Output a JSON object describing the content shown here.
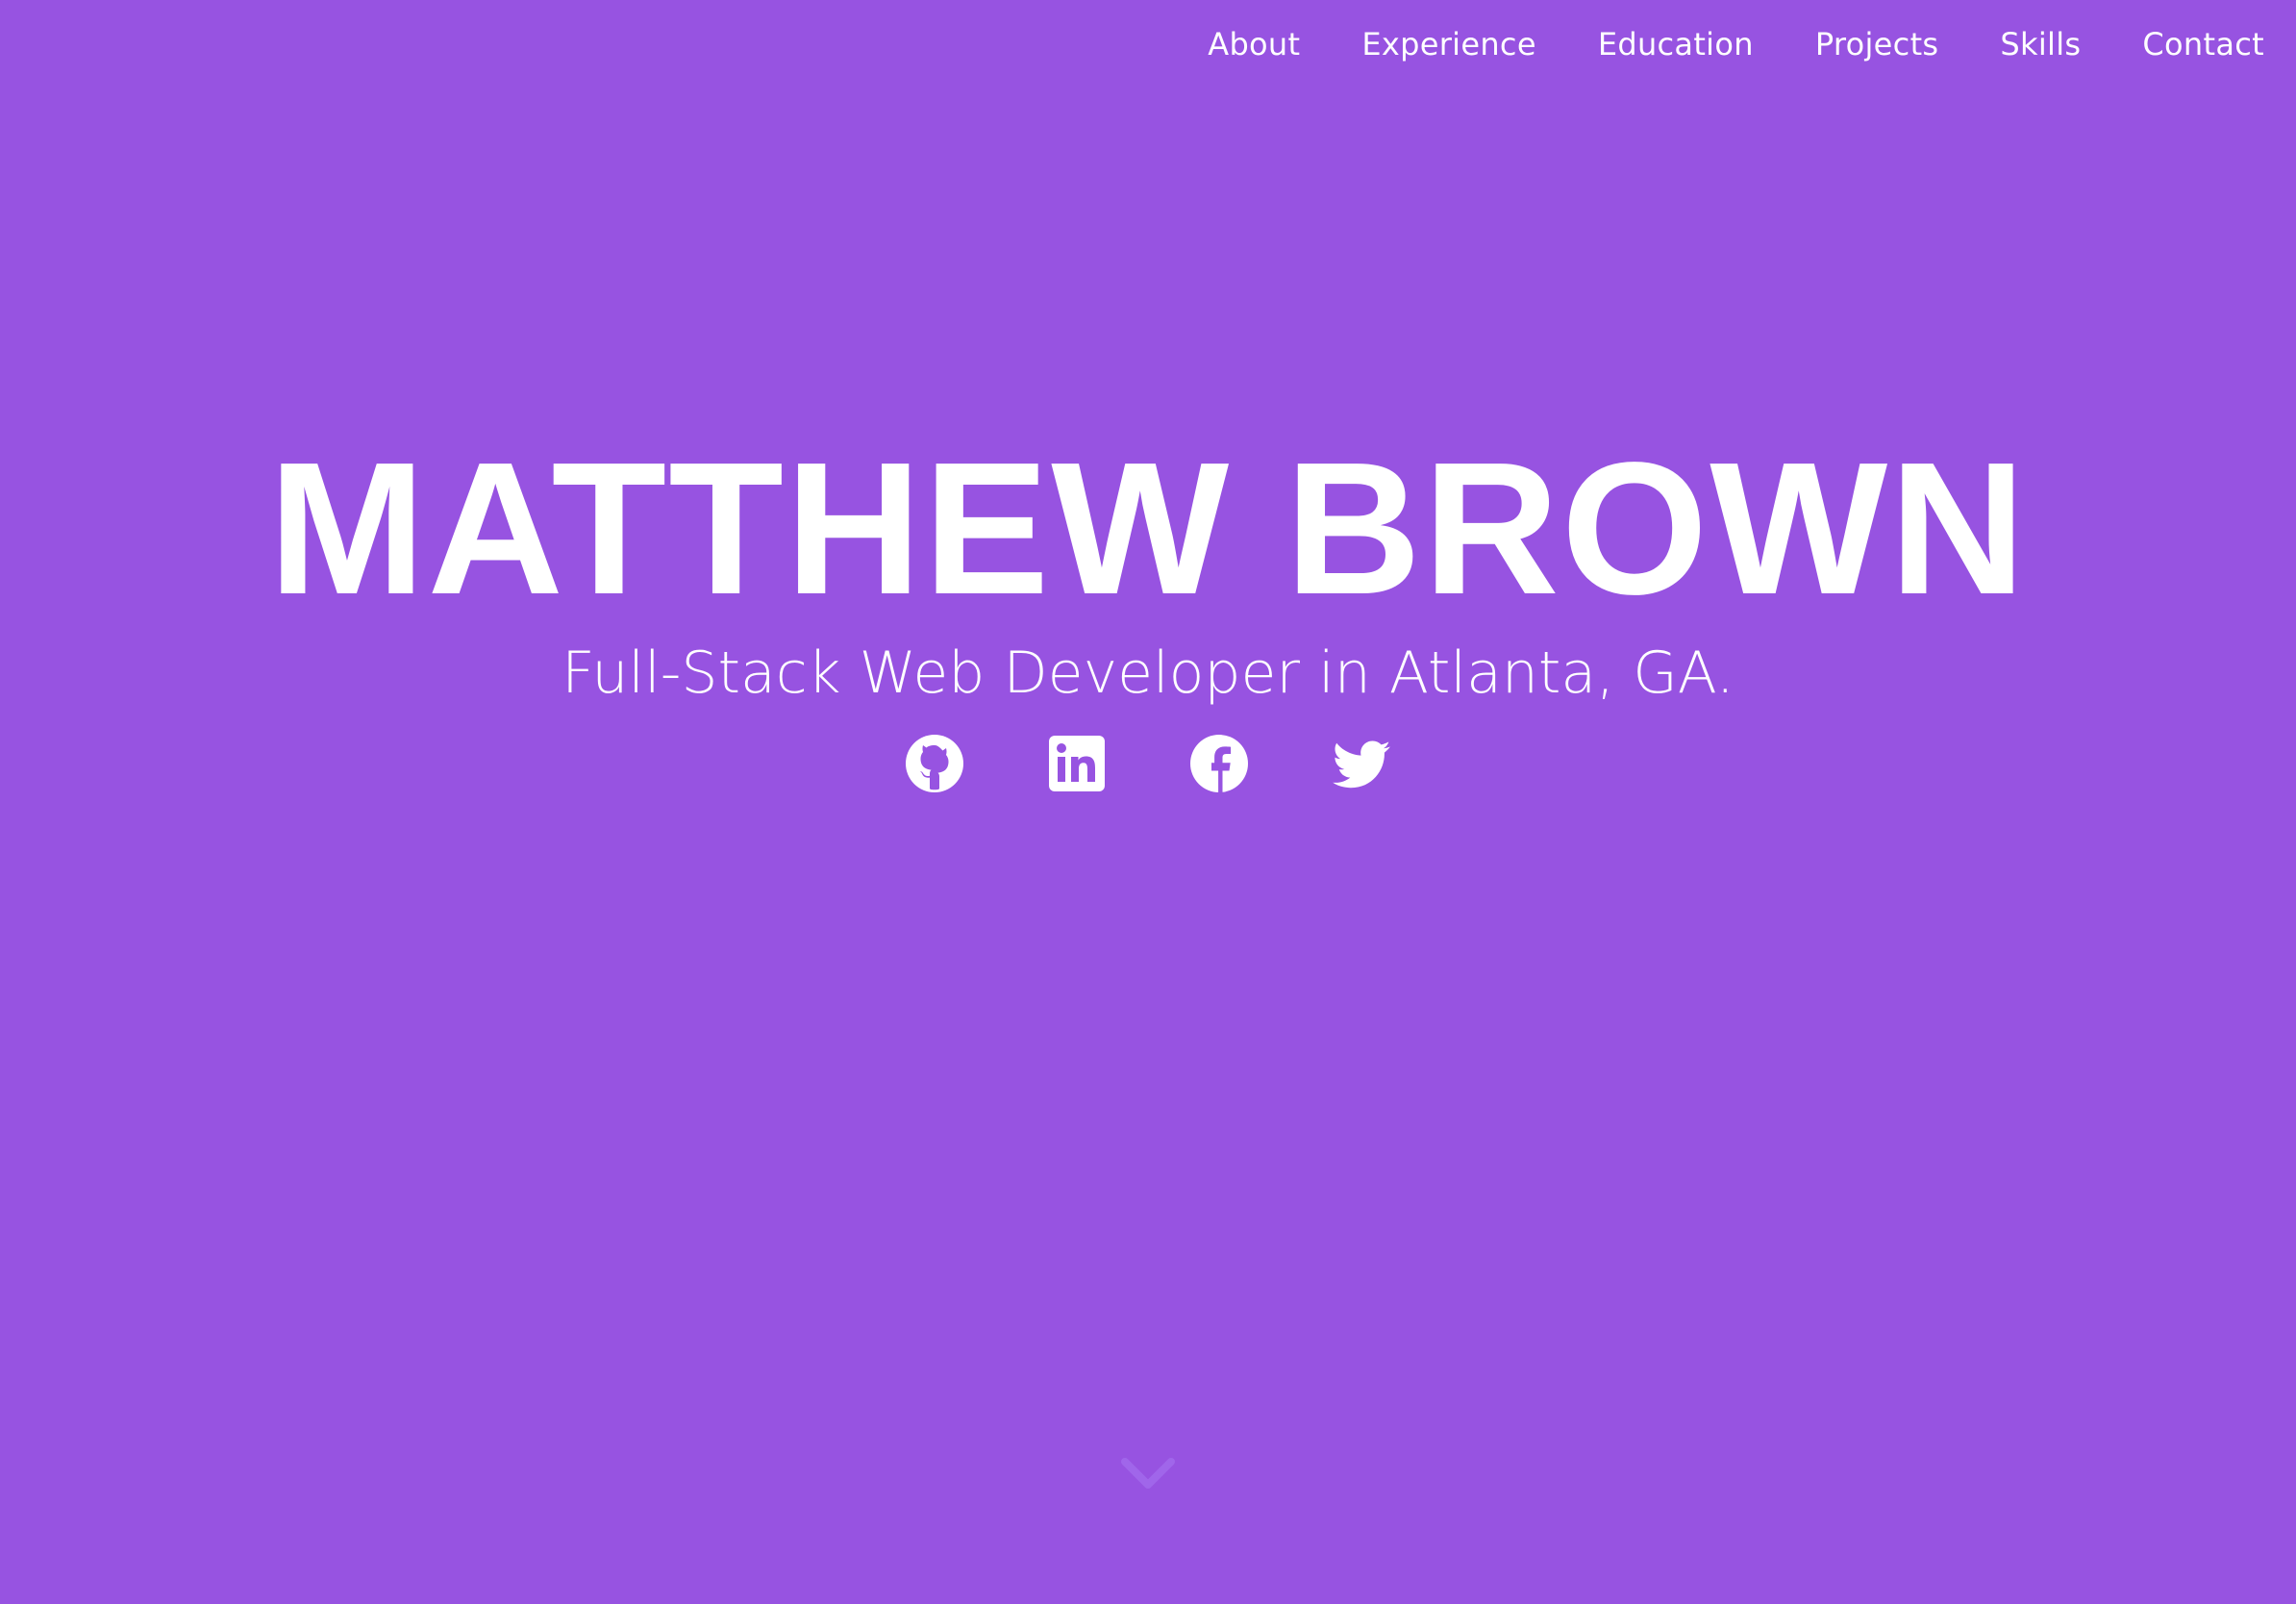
{
  "colors": {
    "background": "#9753e1",
    "text": "#ffffff",
    "scroll_indicator": "#a066ea"
  },
  "nav": {
    "items": [
      {
        "label": "About"
      },
      {
        "label": "Experience"
      },
      {
        "label": "Education"
      },
      {
        "label": "Projects"
      },
      {
        "label": "Skills"
      },
      {
        "label": "Contact"
      }
    ]
  },
  "hero": {
    "name": "MATTHEW BROWN",
    "tagline": "Full-Stack Web Developer in Atlanta, GA."
  },
  "socials": [
    {
      "icon": "github-icon"
    },
    {
      "icon": "linkedin-icon"
    },
    {
      "icon": "facebook-icon"
    },
    {
      "icon": "twitter-icon"
    }
  ],
  "scroll_indicator": {
    "icon": "chevron-down-icon"
  }
}
